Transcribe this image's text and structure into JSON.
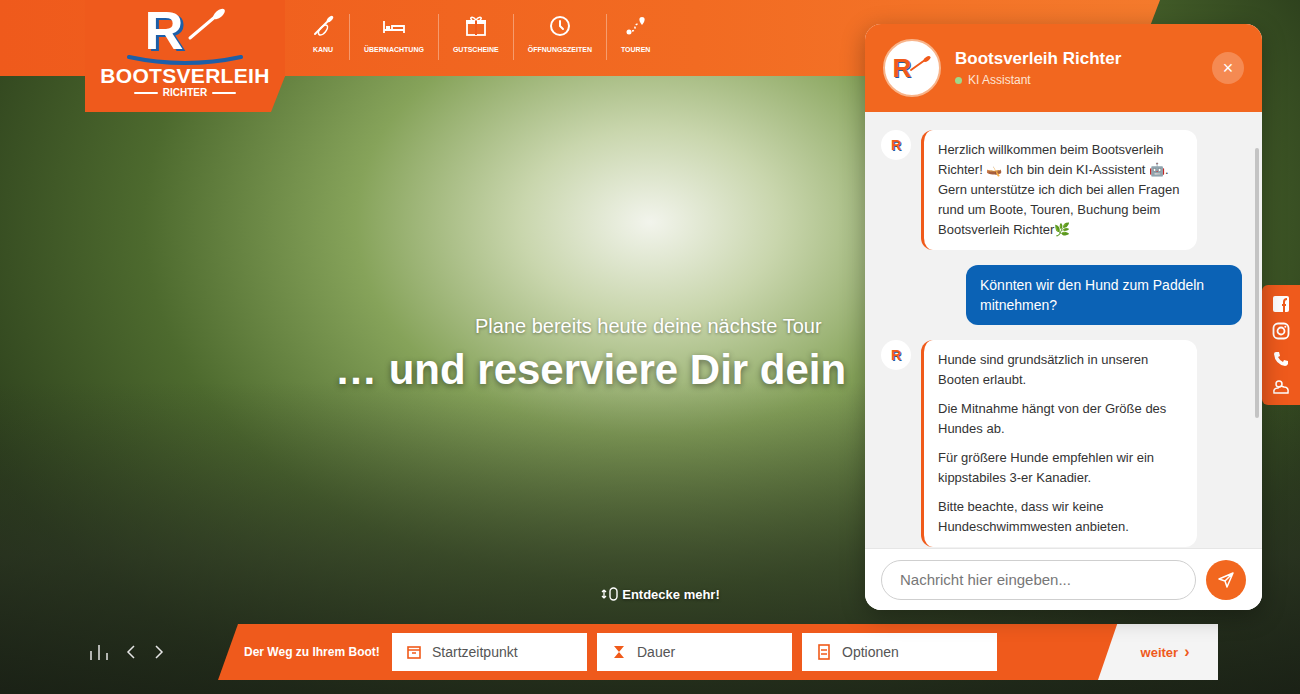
{
  "logo": {
    "letter": "R",
    "name": "BOOTSVERLEIH",
    "subline": "RICHTER"
  },
  "nav": [
    {
      "label": "KANU"
    },
    {
      "label": "ÜBERNACHTUNG"
    },
    {
      "label": "GUTSCHEINE"
    },
    {
      "label": "ÖFFNUNGSZEITEN"
    },
    {
      "label": "TOUREN"
    }
  ],
  "hero": {
    "subtitle": "Plane bereits heute deine nächste Tour",
    "headline": "… und reserviere Dir dein",
    "discover": "Entdecke mehr!"
  },
  "booking": {
    "title": "Der Weg zu Ihrem Boot!",
    "fields": [
      {
        "placeholder": "Startzeitpunkt"
      },
      {
        "placeholder": "Dauer"
      },
      {
        "placeholder": "Optionen"
      }
    ],
    "submit": "weiter",
    "submit_arrow": "›"
  },
  "chat": {
    "title": "Bootsverleih Richter",
    "status": "KI Assistant",
    "online": true,
    "close": "×",
    "messages": [
      {
        "kind": "bot",
        "paragraphs": [
          "Herzlich willkommen beim Bootsverleih Richter! 🛶 Ich bin dein KI-Assistent 🤖. Gern unterstütze ich dich bei allen Fragen rund um Boote, Touren, Buchung beim Bootsverleih Richter🌿"
        ]
      },
      {
        "kind": "user",
        "paragraphs": [
          "Könnten wir den Hund zum Paddeln mitnehmen?"
        ]
      },
      {
        "kind": "bot",
        "paragraphs": [
          "Hunde sind grundsätzlich in unseren Booten erlaubt.",
          "Die Mitnahme hängt von der Größe des Hundes ab.",
          "Für größere Hunde empfehlen wir ein kippstabiles 3-er Kanadier.",
          "Bitte beachte, dass wir keine Hundeschwimmwesten anbieten."
        ]
      }
    ],
    "input": {
      "placeholder": "Nachricht hier eingeben..."
    }
  }
}
